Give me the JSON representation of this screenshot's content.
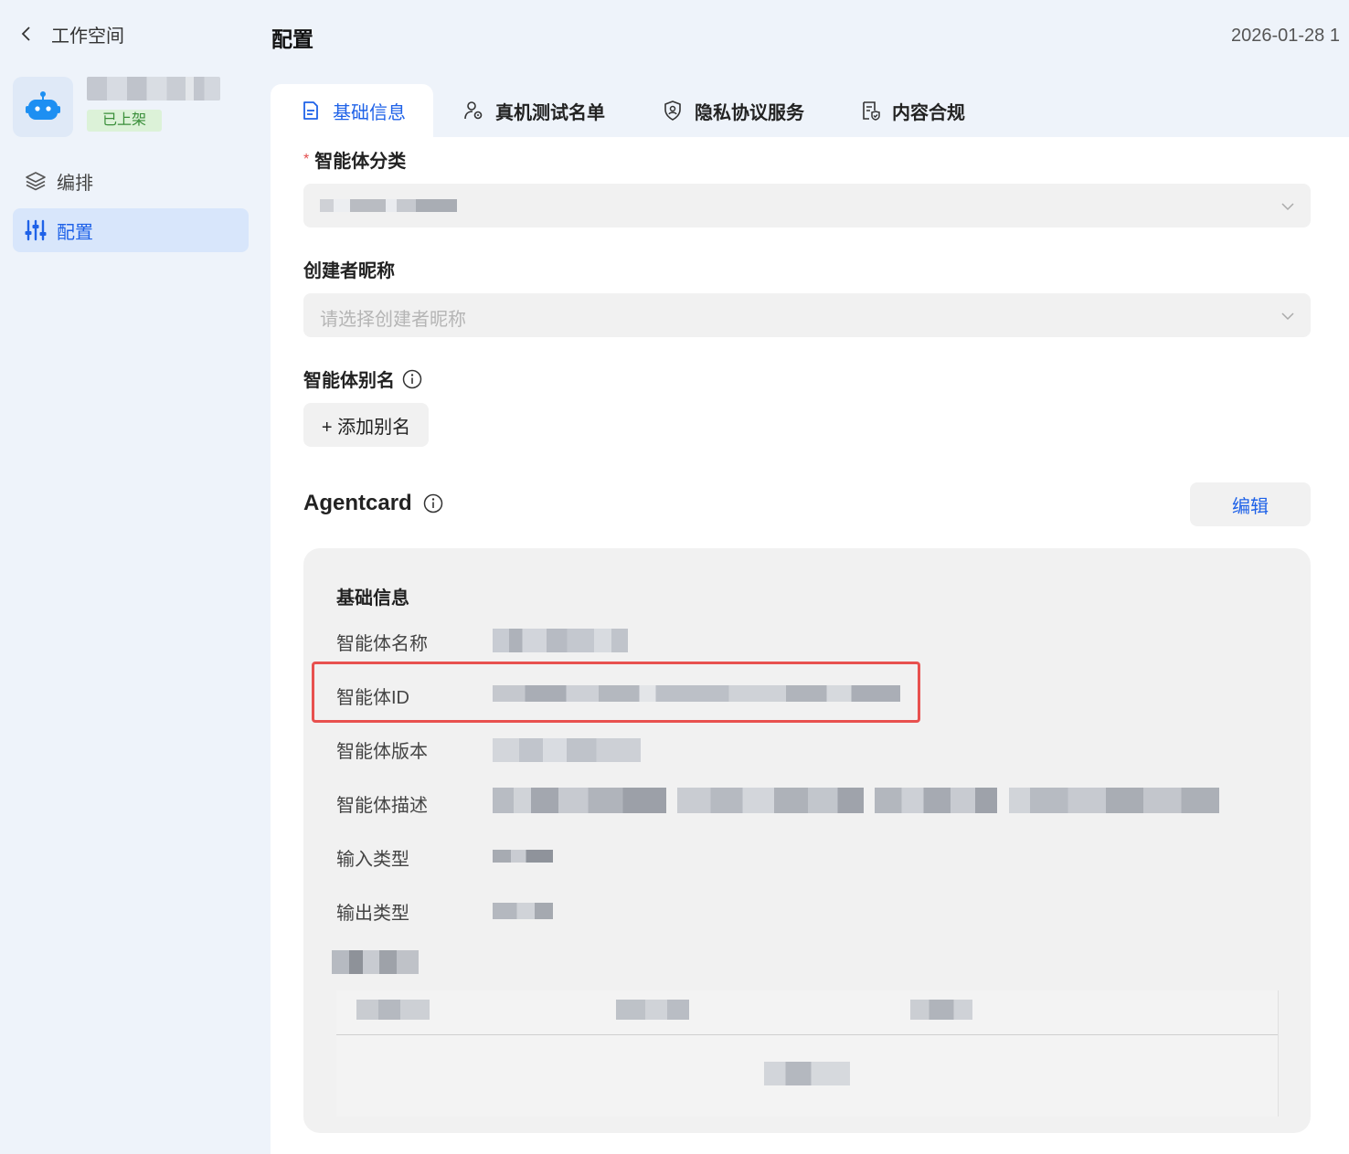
{
  "sidebar": {
    "back_label": "工作空间",
    "app_status": "已上架",
    "nav": [
      {
        "label": "编排",
        "icon": "layers-icon",
        "active": false
      },
      {
        "label": "配置",
        "icon": "sliders-icon",
        "active": true
      }
    ]
  },
  "header": {
    "title": "配置",
    "timestamp": "2026-01-28 1"
  },
  "tabs": [
    {
      "label": "基础信息",
      "icon": "document-icon",
      "active": true
    },
    {
      "label": "真机测试名单",
      "icon": "user-gear-icon",
      "active": false
    },
    {
      "label": "隐私协议服务",
      "icon": "shield-icon",
      "active": false
    },
    {
      "label": "内容合规",
      "icon": "compliance-icon",
      "active": false
    }
  ],
  "form": {
    "category_label": "智能体分类",
    "category_required_mark": "*",
    "creator_label": "创建者昵称",
    "creator_placeholder": "请选择创建者昵称",
    "alias_label": "智能体别名",
    "add_alias_button": "+ 添加别名"
  },
  "agentcard": {
    "title": "Agentcard",
    "edit_button": "编辑",
    "section_heading": "基础信息",
    "rows": [
      {
        "label": "智能体名称"
      },
      {
        "label": "智能体ID"
      },
      {
        "label": "智能体版本"
      },
      {
        "label": "智能体描述"
      },
      {
        "label": "输入类型"
      },
      {
        "label": "输出类型"
      }
    ]
  },
  "colors": {
    "accent": "#1f62e8",
    "highlight_border": "#e8514f",
    "status_green": "#3a8f3a"
  }
}
